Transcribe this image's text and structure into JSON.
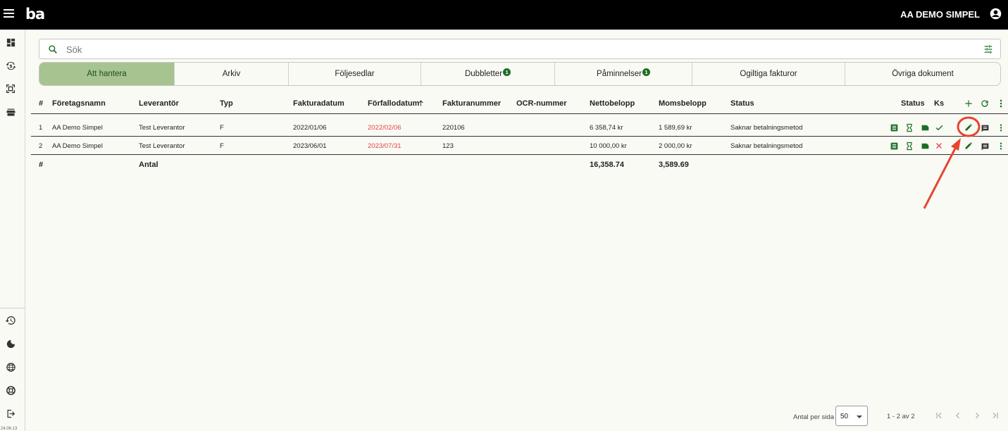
{
  "app": {
    "logo": "ba",
    "user": "AA DEMO SIMPEL"
  },
  "search": {
    "placeholder": "Sök"
  },
  "tabs": [
    {
      "label": "Att hantera",
      "badge": ""
    },
    {
      "label": "Arkiv",
      "badge": ""
    },
    {
      "label": "Följesedlar",
      "badge": ""
    },
    {
      "label": "Dubbletter",
      "badge": "1"
    },
    {
      "label": "Påminnelser",
      "badge": "1"
    },
    {
      "label": "Ogiltiga fakturor",
      "badge": ""
    },
    {
      "label": "Övriga dokument",
      "badge": ""
    }
  ],
  "table": {
    "headers": {
      "num": "#",
      "company": "Företagsnamn",
      "supplier": "Leverantör",
      "type": "Typ",
      "invoice_date": "Fakturadatum",
      "due_date": "Förfallodatum",
      "invoice_no": "Fakturanummer",
      "ocr": "OCR-nummer",
      "net": "Nettobelopp",
      "vat": "Momsbelopp",
      "status": "Status",
      "status2": "Status",
      "ks": "Ks"
    },
    "rows": [
      {
        "num": "1",
        "company": "AA Demo Simpel",
        "supplier": "Test Leverantor",
        "type": "F",
        "invoice_date": "2022/01/06",
        "due_date": "2022/02/06",
        "invoice_no": "220106",
        "ocr": "",
        "net": "6 358,74 kr",
        "vat": "1 589,69 kr",
        "status": "Saknar betalningsmetod",
        "ks": "check"
      },
      {
        "num": "2",
        "company": "AA Demo Simpel",
        "supplier": "Test Leverantor",
        "type": "F",
        "invoice_date": "2023/06/01",
        "due_date": "2023/07/31",
        "invoice_no": "123",
        "ocr": "",
        "net": "10 000,00 kr",
        "vat": "2 000,00 kr",
        "status": "Saknar betalningsmetod",
        "ks": "close"
      }
    ],
    "totals": {
      "num": "#",
      "label": "Antal",
      "net": "16,358.74",
      "vat": "3,589.69"
    }
  },
  "pagination": {
    "per_page_label": "Antal per sida",
    "per_page_value": "50",
    "range": "1 - 2 av 2"
  },
  "colors": {
    "accent": "#1b6e23",
    "active_tab": "#a6c390",
    "overdue": "#e04545",
    "annotation": "#e8452f"
  },
  "rail_icons": [
    "dashboard-icon",
    "sync-money-icon",
    "scan-icon",
    "store-icon",
    "history-icon",
    "moon-icon",
    "globe-icon",
    "lifebuoy-icon",
    "logout-icon"
  ],
  "version": "24.06.13"
}
